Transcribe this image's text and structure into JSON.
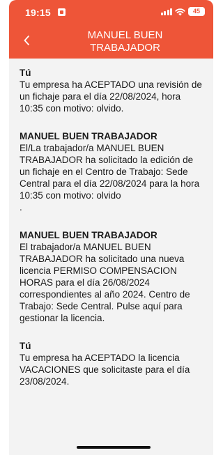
{
  "status_bar": {
    "time": "19:15",
    "battery": "45",
    "icons": [
      "sim-icon",
      "signal-icon",
      "wifi-icon",
      "battery-icon"
    ]
  },
  "header": {
    "back_icon": "chevron-left-icon",
    "title": "MANUEL BUEN\nTRABAJADOR"
  },
  "colors": {
    "accent": "#ee5538",
    "content_background": "#f3f3f3",
    "text": "#1a1a1a"
  },
  "messages": [
    {
      "sender": "Tú",
      "body": "Tu empresa ha ACEPTADO una revisión de un fichaje para el día 22/08/2024, hora 10:35 con motivo: olvido."
    },
    {
      "sender": "MANUEL BUEN TRABAJADOR",
      "body": "El/La trabajador/a MANUEL BUEN TRABAJADOR ha solicitado la edición de un fichaje en el Centro de Trabajo: Sede Central para el día 22/08/2024 para la hora 10:35 con motivo: olvido\n."
    },
    {
      "sender": "MANUEL BUEN TRABAJADOR",
      "body": "El trabajador/a MANUEL BUEN TRABAJADOR ha solicitado una nueva licencia PERMISO COMPENSACION HORAS para el día 26/08/2024 correspondientes al año 2024. Centro de Trabajo: Sede Central. Pulse  aquí para gestionar la licencia."
    },
    {
      "sender": "Tú",
      "body": "Tu empresa ha ACEPTADO la licencia VACACIONES que solicitaste para el día 23/08/2024."
    }
  ]
}
